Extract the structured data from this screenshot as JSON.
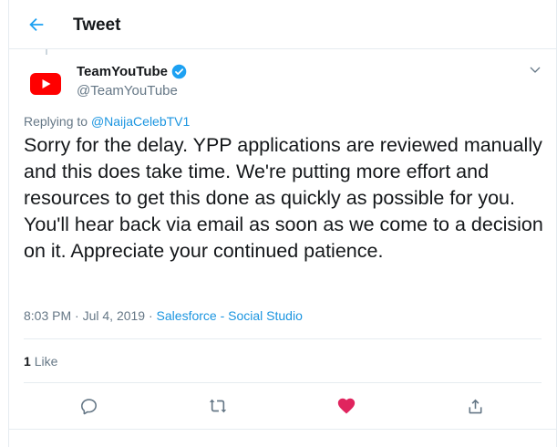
{
  "header": {
    "title": "Tweet",
    "back_icon": "arrow-left-icon"
  },
  "author": {
    "display_name": "TeamYouTube",
    "handle": "@TeamYouTube",
    "verified": true,
    "avatar_icon": "youtube-logo-icon"
  },
  "tweet": {
    "replying_prefix": "Replying to",
    "replying_to": "@NaijaCelebTV1",
    "text": "Sorry for the delay. YPP applications are reviewed manually and this does take time. We're putting more effort and resources to get this done as quickly as possible for you. You'll hear back via email as soon as we come to a decision on it. Appreciate your continued patience.",
    "time": "8:03 PM",
    "date": "Jul 4, 2019",
    "separator": " · ",
    "source": "Salesforce - Social Studio"
  },
  "stats": {
    "like_count": "1",
    "like_label": "Like"
  },
  "actions": [
    {
      "name": "reply",
      "icon": "reply-icon"
    },
    {
      "name": "retweet",
      "icon": "retweet-icon"
    },
    {
      "name": "like",
      "icon": "heart-icon",
      "active": true
    },
    {
      "name": "share",
      "icon": "share-icon"
    }
  ],
  "colors": {
    "accent": "#1da1f2",
    "link": "#1b95e0",
    "like": "#e0245e",
    "muted": "#657786",
    "youtube_red": "#ff0000"
  }
}
